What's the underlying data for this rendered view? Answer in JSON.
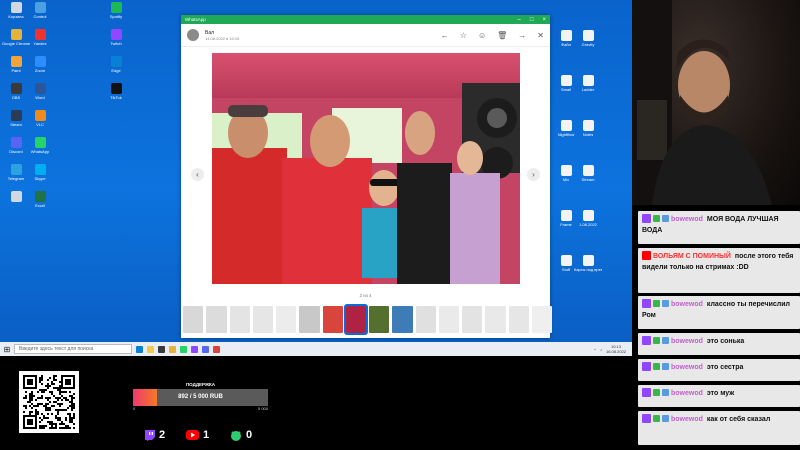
{
  "desktop": {
    "icons": [
      {
        "label": "Корзина",
        "color": "#cfd8e3"
      },
      {
        "label": "Google Chrome",
        "color": "#e8b23a"
      },
      {
        "label": "Paint",
        "color": "#f2a33a"
      },
      {
        "label": "OBS",
        "color": "#3a3a3a"
      },
      {
        "label": "Steam",
        "color": "#2a3b55"
      },
      {
        "label": "Discord",
        "color": "#5865f2"
      },
      {
        "label": "Telegram",
        "color": "#2aa3e0"
      },
      {
        "label": "",
        "color": "#cfd8e3"
      },
      {
        "label": "Control",
        "color": "#4aa0e0"
      },
      {
        "label": "Yandex",
        "color": "#e33"
      },
      {
        "label": "Zoom",
        "color": "#2d8cff"
      },
      {
        "label": "Word",
        "color": "#2b579a"
      },
      {
        "label": "VLC",
        "color": "#f08a1a"
      },
      {
        "label": "WhatsApp",
        "color": "#25d366"
      },
      {
        "label": "Skype",
        "color": "#00aff0"
      },
      {
        "label": "Excel",
        "color": "#217346"
      },
      {
        "label": "Spotify",
        "color": "#1db954"
      },
      {
        "label": "Twitch",
        "color": "#9146ff"
      },
      {
        "label": "Edge",
        "color": "#0a7fd8"
      },
      {
        "label": "TikTok",
        "color": "#111"
      }
    ],
    "right_icons": [
      {
        "label": "Файл"
      },
      {
        "label": "Gravity"
      },
      {
        "label": "Small"
      },
      {
        "label": "Ladder"
      },
      {
        "label": "Nightflow"
      },
      {
        "label": "Notes"
      },
      {
        "label": "Mix"
      },
      {
        "label": "Stream"
      },
      {
        "label": "Frame"
      },
      {
        "label": "1.08.2022"
      },
      {
        "label": "Stuff"
      },
      {
        "label": "Карты под времени"
      }
    ]
  },
  "taskbar": {
    "search_placeholder": "Введите здесь текст для поиска",
    "time": "10:13",
    "date": "16.08.2022"
  },
  "viewer": {
    "app_title": "WhatsApp",
    "sender_name": "Вал",
    "sender_date": "14.08.2022 в 10:15",
    "counter": "2 из 4",
    "thumb_colors": [
      "#d8d8d8",
      "#dcdcdc",
      "#e4e4e4",
      "#e6e6e6",
      "#ececec",
      "#c8c8c8",
      "#d9443c",
      "#b02244",
      "#546f2f",
      "#3d7cb6",
      "#e0e0e0",
      "#eaeaea",
      "#e3e3e3",
      "#e9e9e9",
      "#e6e6e6",
      "#efefef"
    ]
  },
  "chat": {
    "messages": [
      {
        "platform": "twitch",
        "user": "bowewod",
        "text": "МОЯ ВОДА ЛУЧШАЯ ВОДА"
      },
      {
        "platform": "youtube",
        "user": "ВОЛЬЯМ С ПОМИНЫЙ",
        "text": "после этого тебя видели только на стримах :DD"
      },
      {
        "platform": "twitch",
        "user": "bowewod",
        "text": "классно ты перечислил Ром"
      },
      {
        "platform": "twitch",
        "user": "bowewod",
        "text": "это сонька"
      },
      {
        "platform": "twitch",
        "user": "bowewod",
        "text": "это сестра"
      },
      {
        "platform": "twitch",
        "user": "bowewod",
        "text": "это муж"
      },
      {
        "platform": "twitch",
        "user": "bowewod",
        "text": "как от себя сказал"
      }
    ]
  },
  "donation": {
    "label": "ПОДДЕРЖКА",
    "text": "892 / 5 000 RUB",
    "min": "0",
    "max": "5 000",
    "progress": 0.18
  },
  "stats": {
    "twitch": "2",
    "youtube": "1",
    "other": "0"
  },
  "colors": {
    "twitch": "#9146ff",
    "youtube": "#ff0000",
    "whatsapp_green": "#1fa855",
    "other": "#2ecc71"
  }
}
